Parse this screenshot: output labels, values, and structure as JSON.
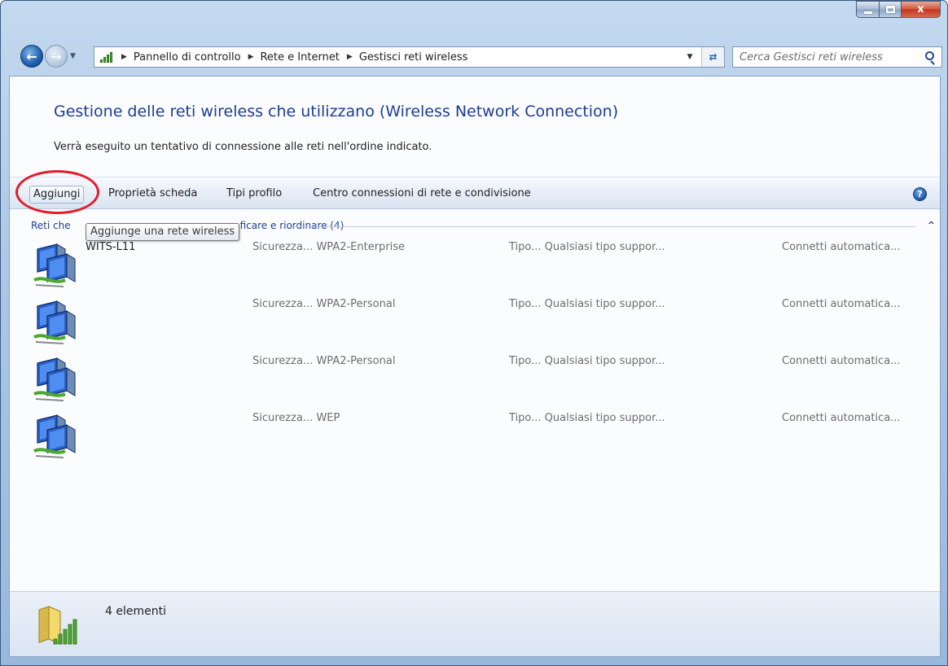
{
  "window": {
    "caption_minimize": "–",
    "caption_maximize": "□",
    "caption_close": "x"
  },
  "address": {
    "crumbs": [
      "Pannello di controllo",
      "Rete e Internet",
      "Gestisci reti wireless"
    ],
    "separator": "▶"
  },
  "search": {
    "placeholder": "Cerca Gestisci reti wireless"
  },
  "page": {
    "title": "Gestione delle reti wireless che utilizzano (Wireless Network Connection)",
    "subtitle": "Verrà eseguito un tentativo di connessione alle reti nell'ordine indicato."
  },
  "toolbar": {
    "add_label": "Aggiungi",
    "properties_label": "Proprietà scheda",
    "profile_types_label": "Tipi profilo",
    "network_center_label": "Centro connessioni di rete e condivisione",
    "help_label": "?"
  },
  "tooltip": {
    "text": "Aggiunge una rete wireless"
  },
  "group": {
    "header_visible_start": "Reti che",
    "header_visible_end": "ficare e riordinare (4)"
  },
  "networks": [
    {
      "name": "WITS-L11",
      "security": "Sicurezza... WPA2-Enterprise",
      "type": "Tipo... Qualsiasi tipo suppor...",
      "mode": "Connetti automatica..."
    },
    {
      "name": "",
      "security": "Sicurezza... WPA2-Personal",
      "type": "Tipo... Qualsiasi tipo suppor...",
      "mode": "Connetti automatica..."
    },
    {
      "name": "",
      "security": "Sicurezza... WPA2-Personal",
      "type": "Tipo... Qualsiasi tipo suppor...",
      "mode": "Connetti automatica..."
    },
    {
      "name": "",
      "security": "Sicurezza... WEP",
      "type": "Tipo... Qualsiasi tipo suppor...",
      "mode": "Connetti automatica..."
    }
  ],
  "status": {
    "count_text": "4 elementi"
  },
  "colors": {
    "link_blue": "#1e3d91",
    "highlight_red": "#e21d2a",
    "signal_green": "#4ca92f"
  },
  "icons": {
    "back": "back-arrow-icon",
    "forward": "forward-arrow-icon",
    "network": "wireless-network-icon",
    "folder": "network-folder-icon",
    "help": "help-icon",
    "search": "search-icon",
    "refresh": "refresh-icon"
  }
}
